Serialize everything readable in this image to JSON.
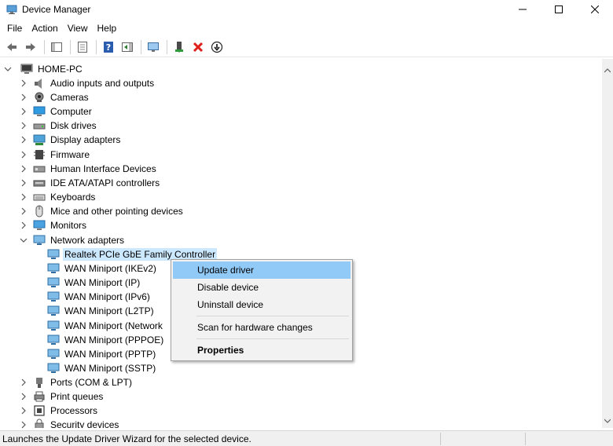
{
  "window": {
    "title": "Device Manager"
  },
  "menu": [
    "File",
    "Action",
    "View",
    "Help"
  ],
  "toolbar": {
    "icons": [
      "back-icon",
      "forward-icon",
      "show-hide-console-tree-icon",
      "properties-icon",
      "help-icon",
      "action-pane-icon",
      "monitor-icon",
      "enable-device-icon",
      "uninstall-x-icon",
      "update-driver-icon"
    ]
  },
  "tree": {
    "root": "HOME-PC",
    "categories_top": [
      {
        "label": "Audio inputs and outputs",
        "icon": "speaker-icon"
      },
      {
        "label": "Cameras",
        "icon": "camera-icon"
      },
      {
        "label": "Computer",
        "icon": "computer-icon"
      },
      {
        "label": "Disk drives",
        "icon": "disk-drive-icon"
      },
      {
        "label": "Display adapters",
        "icon": "display-adapter-icon"
      },
      {
        "label": "Firmware",
        "icon": "firmware-icon"
      },
      {
        "label": "Human Interface Devices",
        "icon": "hid-icon"
      },
      {
        "label": "IDE ATA/ATAPI controllers",
        "icon": "ide-controller-icon"
      },
      {
        "label": "Keyboards",
        "icon": "keyboard-icon"
      },
      {
        "label": "Mice and other pointing devices",
        "icon": "mouse-icon"
      },
      {
        "label": "Monitors",
        "icon": "monitor-icon"
      }
    ],
    "network": {
      "label": "Network adapters",
      "children": [
        "Realtek PCIe GbE Family Controller",
        "WAN Miniport (IKEv2)",
        "WAN Miniport (IP)",
        "WAN Miniport (IPv6)",
        "WAN Miniport (L2TP)",
        "WAN Miniport (Network",
        "WAN Miniport (PPPOE)",
        "WAN Miniport (PPTP)",
        "WAN Miniport (SSTP)"
      ]
    },
    "categories_bottom": [
      {
        "label": "Ports (COM & LPT)",
        "icon": "port-icon"
      },
      {
        "label": "Print queues",
        "icon": "printer-icon"
      },
      {
        "label": "Processors",
        "icon": "processor-icon"
      },
      {
        "label": "Security devices",
        "icon": "security-device-icon"
      }
    ]
  },
  "context_menu": {
    "items": [
      "Update driver",
      "Disable device",
      "Uninstall device"
    ],
    "scan": "Scan for hardware changes",
    "properties": "Properties"
  },
  "status": {
    "text": "Launches the Update Driver Wizard for the selected device."
  },
  "colors": {
    "selection": "#cce8ff",
    "menu_highlight": "#91c9f7",
    "icon_blue": "#1e88d2"
  }
}
